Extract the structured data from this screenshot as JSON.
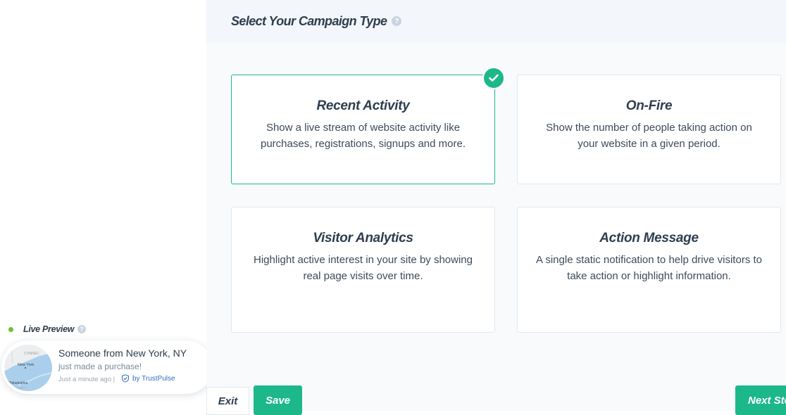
{
  "header": {
    "title": "Select Your Campaign Type",
    "help_icon": "?"
  },
  "campaign_types": [
    {
      "title": "Recent Activity",
      "description": "Show a live stream of website activity like purchases, registrations, signups and more.",
      "selected": true
    },
    {
      "title": "On-Fire",
      "description": "Show the number of people taking action on your website in a given period.",
      "selected": false
    },
    {
      "title": "Visitor Analytics",
      "description": "Highlight active interest in your site by showing real page visits over time.",
      "selected": false
    },
    {
      "title": "Action Message",
      "description": "A single static notification to help drive visitors to take action or highlight information.",
      "selected": false
    }
  ],
  "live_preview": {
    "label": "Live Preview",
    "help_icon": "?",
    "notification": {
      "title": "Someone from New York, NY",
      "subtitle": "just made a purchase!",
      "time": "Just a minute ago |",
      "brand": "by TrustPulse",
      "map_labels": {
        "connecticut": "CONNEC",
        "new_york": "New York",
        "philadelphia": "Philadelphia",
        "new_jersey": "N JERSEY"
      }
    }
  },
  "footer": {
    "exit_label": "Exit",
    "save_label": "Save",
    "next_label": "Next Step"
  },
  "colors": {
    "accent": "#1cb88a",
    "live_dot": "#6fbf3a",
    "title_text": "#2f3d4e"
  }
}
